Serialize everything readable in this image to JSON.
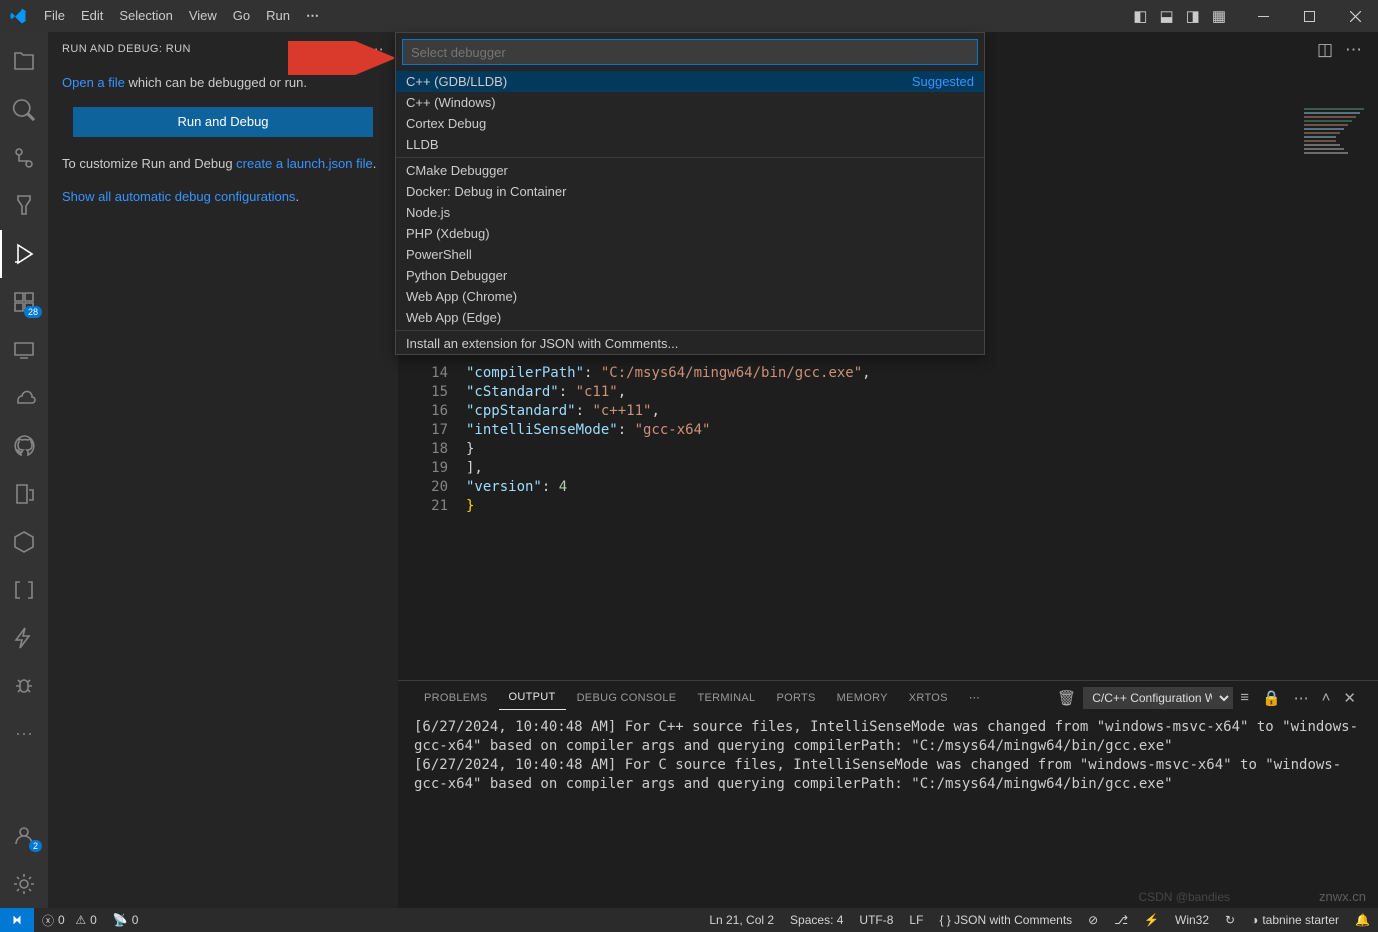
{
  "menu": {
    "items": [
      "File",
      "Edit",
      "Selection",
      "View",
      "Go",
      "Run"
    ],
    "overflow": "⋯"
  },
  "layout_icons": [
    "panel-left-icon",
    "panel-bottom-icon",
    "panel-right-icon",
    "layout-icon"
  ],
  "activity": {
    "items": [
      {
        "name": "explorer-icon",
        "active": false,
        "badge": null
      },
      {
        "name": "search-icon",
        "active": false,
        "badge": null
      },
      {
        "name": "source-control-icon",
        "active": false,
        "badge": null
      },
      {
        "name": "test-icon",
        "active": false,
        "badge": null
      },
      {
        "name": "run-debug-icon",
        "active": true,
        "badge": null
      },
      {
        "name": "extensions-icon",
        "active": false,
        "badge": "28"
      },
      {
        "name": "remote-icon",
        "active": false,
        "badge": null
      },
      {
        "name": "cloud-icon",
        "active": false,
        "badge": null
      },
      {
        "name": "github-icon",
        "active": false,
        "badge": null
      },
      {
        "name": "device-icon",
        "active": false,
        "badge": null
      },
      {
        "name": "hex-icon",
        "active": false,
        "badge": null
      },
      {
        "name": "brackets-icon",
        "active": false,
        "badge": null
      },
      {
        "name": "thunder-icon",
        "active": false,
        "badge": null
      },
      {
        "name": "bug-icon",
        "active": false,
        "badge": null
      },
      {
        "name": "overflow-icon",
        "active": false,
        "badge": null
      }
    ],
    "bottom": [
      {
        "name": "accounts-icon",
        "badge": "2"
      },
      {
        "name": "settings-gear-icon",
        "badge": null
      }
    ]
  },
  "sidebar": {
    "title": "RUN AND DEBUG: RUN",
    "open_text": "Open a file",
    "open_rest": " which can be debugged or run.",
    "run_button": "Run and Debug",
    "customize_pre": "To customize Run and Debug ",
    "customize_link": "create a launch.json file",
    "show_all": "Show all automatic debug configurations",
    "period": "."
  },
  "quickpick": {
    "placeholder": "Select debugger",
    "suggested": "Suggested",
    "items": [
      {
        "label": "C++ (GDB/LLDB)",
        "suggested": true,
        "selected": true
      },
      {
        "label": "C++ (Windows)"
      },
      {
        "label": "Cortex Debug"
      },
      {
        "label": "LLDB"
      }
    ],
    "items2": [
      {
        "label": "CMake Debugger"
      },
      {
        "label": "Docker: Debug in Container"
      },
      {
        "label": "Node.js"
      },
      {
        "label": "PHP (Xdebug)"
      },
      {
        "label": "PowerShell"
      },
      {
        "label": "Python Debugger"
      },
      {
        "label": "Web App (Chrome)"
      },
      {
        "label": "Web App (Edge)"
      }
    ],
    "install": "Install an extension for JSON with Comments..."
  },
  "editor": {
    "lines": [
      {
        "n": 14,
        "indent": 5,
        "html": "<span class='tok-prop'>\"compilerPath\"</span><span class='tok-punc'>: </span><span class='tok-str'>\"C:/msys64/mingw64/bin/gcc.exe\"</span><span class='tok-punc'>,</span>"
      },
      {
        "n": 15,
        "indent": 5,
        "html": "<span class='tok-prop'>\"cStandard\"</span><span class='tok-punc'>: </span><span class='tok-str'>\"c11\"</span><span class='tok-punc'>,</span>"
      },
      {
        "n": 16,
        "indent": 5,
        "html": "<span class='tok-prop'>\"cppStandard\"</span><span class='tok-punc'>: </span><span class='tok-str'>\"c++11\"</span><span class='tok-punc'>,</span>"
      },
      {
        "n": 17,
        "indent": 5,
        "html": "<span class='tok-prop'>\"intelliSenseMode\"</span><span class='tok-punc'>: </span><span class='tok-str'>\"gcc-x64\"</span>"
      },
      {
        "n": 18,
        "indent": 4,
        "html": "<span class='tok-punc'>}</span>"
      },
      {
        "n": 19,
        "indent": 2,
        "html": "<span class='tok-punc'>],</span>"
      },
      {
        "n": 20,
        "indent": 2,
        "html": "<span class='tok-prop'>\"version\"</span><span class='tok-punc'>: </span><span class='tok-num'>4</span>"
      },
      {
        "n": 21,
        "indent": 0,
        "html": "<span class='tok-brace'>}</span>"
      }
    ]
  },
  "panel": {
    "tabs": [
      "PROBLEMS",
      "OUTPUT",
      "DEBUG CONSOLE",
      "TERMINAL",
      "PORTS",
      "MEMORY",
      "XRTOS"
    ],
    "active": "OUTPUT",
    "select": "C/C++ Configuration W",
    "log1": "[6/27/2024, 10:40:48 AM] For C++ source files, IntelliSenseMode was changed from \"windows-msvc-x64\" to \"windows-gcc-x64\" based on compiler args and querying compilerPath: \"C:/msys64/mingw64/bin/gcc.exe\"",
    "log2": "[6/27/2024, 10:40:48 AM] For C source files, IntelliSenseMode was changed from \"windows-msvc-x64\" to \"windows-gcc-x64\" based on compiler args and querying compilerPath: \"C:/msys64/mingw64/bin/gcc.exe\""
  },
  "status": {
    "errors": "0",
    "warnings": "0",
    "radio": "0",
    "lncol": "Ln 21, Col 2",
    "spaces": "Spaces: 4",
    "encoding": "UTF-8",
    "eol": "LF",
    "lang": "{ }  JSON with Comments",
    "win32": "Win32",
    "tabnine": "tabnine starter"
  },
  "watermark": "znwx.cn",
  "watermark2": "CSDN @bandies"
}
